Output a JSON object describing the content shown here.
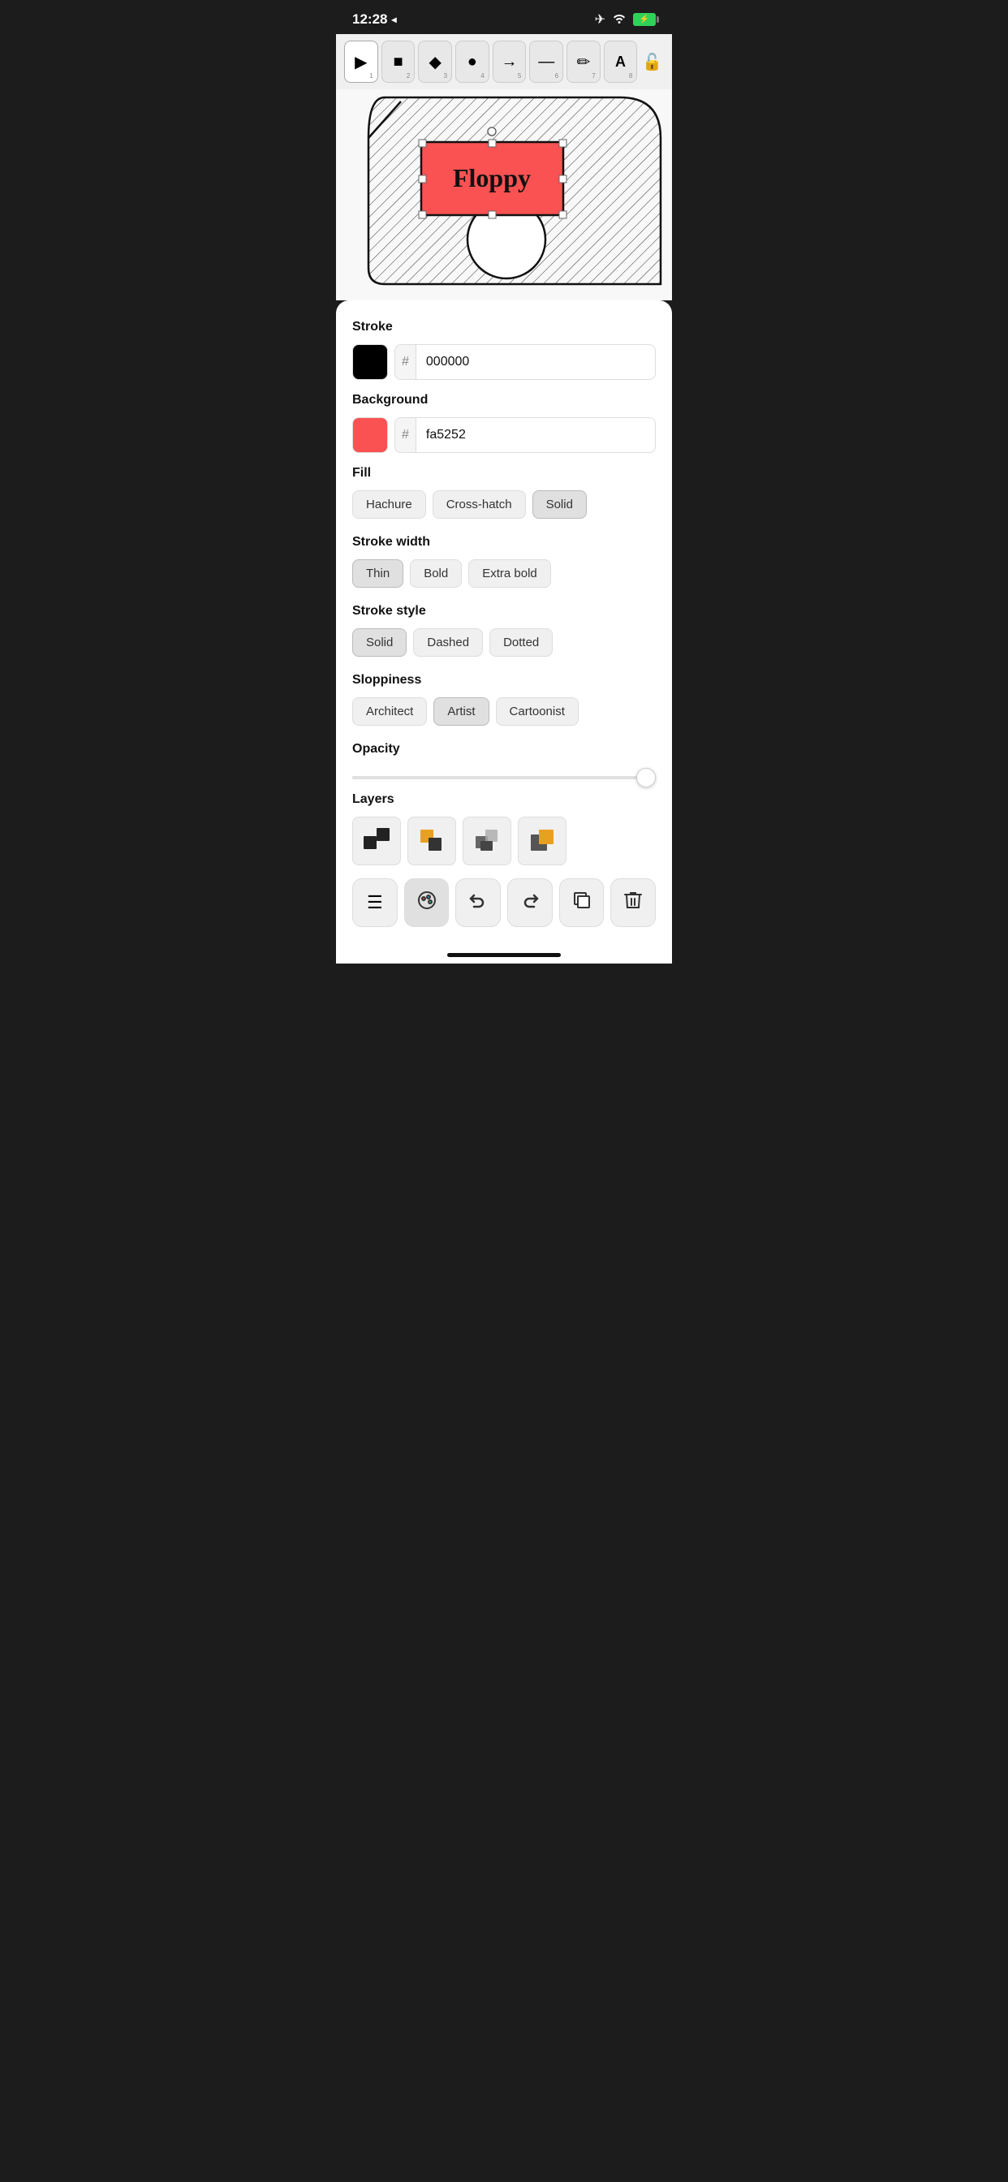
{
  "statusBar": {
    "time": "12:28",
    "locationIcon": "◂",
    "wifiIcon": "wifi",
    "batteryIcon": "⚡"
  },
  "toolbar": {
    "tools": [
      {
        "label": "▶",
        "num": "1",
        "active": false,
        "name": "select-tool"
      },
      {
        "label": "■",
        "num": "2",
        "active": false,
        "name": "rectangle-tool"
      },
      {
        "label": "◆",
        "num": "3",
        "active": false,
        "name": "diamond-tool"
      },
      {
        "label": "●",
        "num": "4",
        "active": false,
        "name": "circle-tool"
      },
      {
        "label": "→",
        "num": "5",
        "active": false,
        "name": "arrow-tool"
      },
      {
        "label": "—",
        "num": "6",
        "active": false,
        "name": "line-tool"
      },
      {
        "label": "✏",
        "num": "7",
        "active": false,
        "name": "pencil-tool"
      },
      {
        "label": "A",
        "num": "8",
        "active": false,
        "name": "text-tool"
      }
    ],
    "lockLabel": "🔓"
  },
  "panel": {
    "strokeLabel": "Stroke",
    "strokeColor": "#000000",
    "strokeHex": "000000",
    "backgroundLabel": "Background",
    "bgColor": "#fa5252",
    "bgHex": "fa5252",
    "fillLabel": "Fill",
    "fillOptions": [
      {
        "label": "Hachure",
        "active": false
      },
      {
        "label": "Cross-hatch",
        "active": false
      },
      {
        "label": "Solid",
        "active": true
      }
    ],
    "strokeWidthLabel": "Stroke width",
    "strokeWidthOptions": [
      {
        "label": "Thin",
        "active": true
      },
      {
        "label": "Bold",
        "active": false
      },
      {
        "label": "Extra bold",
        "active": false
      }
    ],
    "strokeStyleLabel": "Stroke style",
    "strokeStyleOptions": [
      {
        "label": "Solid",
        "active": true
      },
      {
        "label": "Dashed",
        "active": false
      },
      {
        "label": "Dotted",
        "active": false
      }
    ],
    "sloppinessLabel": "Sloppiness",
    "sloppinessOptions": [
      {
        "label": "Architect",
        "active": false
      },
      {
        "label": "Artist",
        "active": true
      },
      {
        "label": "Cartoonist",
        "active": false
      }
    ],
    "opacityLabel": "Opacity",
    "opacityValue": 100,
    "layersLabel": "Layers",
    "bottomTools": [
      {
        "icon": "☰",
        "name": "menu-button",
        "active": false
      },
      {
        "icon": "🎨",
        "name": "style-button",
        "active": true
      },
      {
        "icon": "↺",
        "name": "undo-button",
        "active": false
      },
      {
        "icon": "↻",
        "name": "redo-button",
        "active": false
      },
      {
        "icon": "⧉",
        "name": "layers-button",
        "active": false
      },
      {
        "icon": "🗑",
        "name": "delete-button",
        "active": false
      }
    ]
  }
}
